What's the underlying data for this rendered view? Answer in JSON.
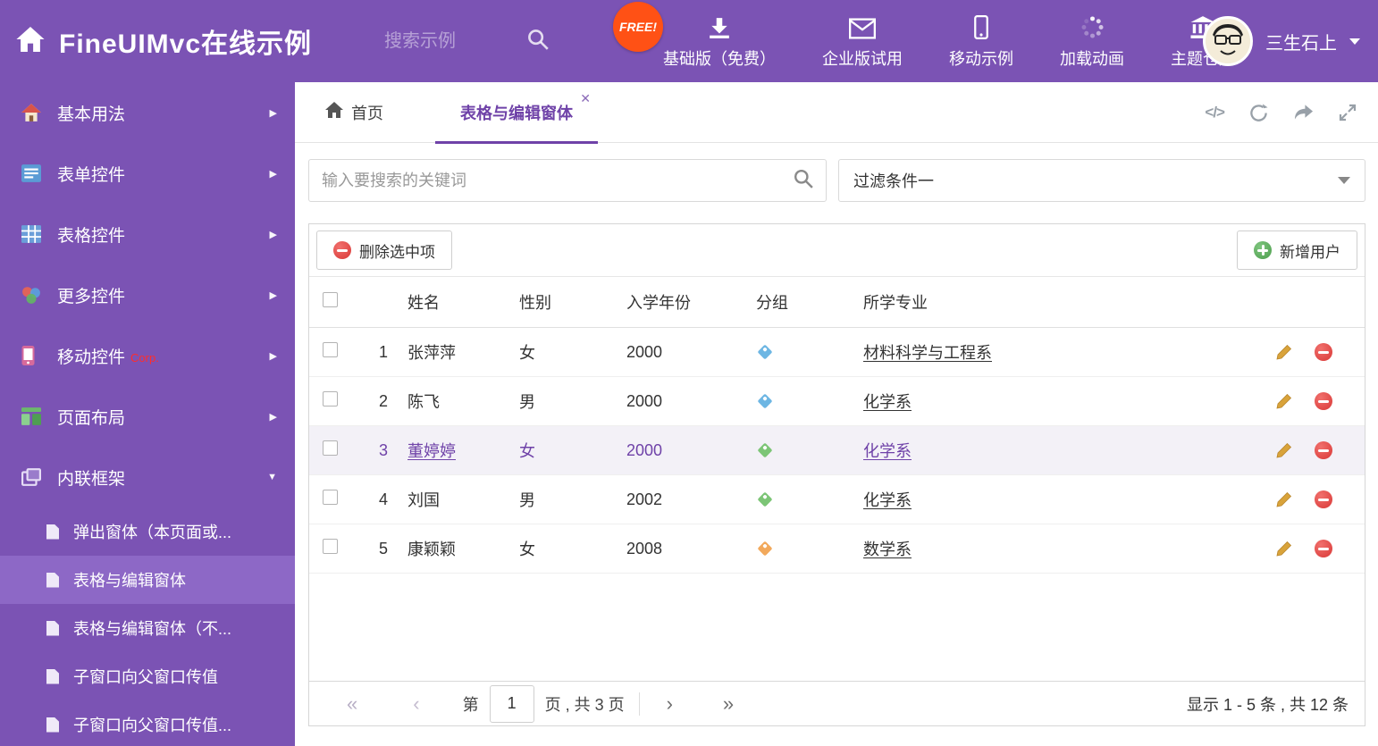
{
  "header": {
    "title": "FineUIMvc在线示例",
    "search_placeholder": "搜索示例",
    "free_badge": "FREE!",
    "nav": [
      {
        "label": "基础版（免费）",
        "icon": "download-icon"
      },
      {
        "label": "企业版试用",
        "icon": "envelope-icon"
      },
      {
        "label": "移动示例",
        "icon": "mobile-icon"
      },
      {
        "label": "加载动画",
        "icon": "spinner-icon"
      },
      {
        "label": "主题仓库",
        "icon": "bank-icon"
      }
    ],
    "user": {
      "name": "三生石上"
    }
  },
  "sidebar": {
    "items": [
      {
        "label": "基本用法"
      },
      {
        "label": "表单控件"
      },
      {
        "label": "表格控件"
      },
      {
        "label": "更多控件"
      },
      {
        "label": "移动控件",
        "badge": "Corp."
      },
      {
        "label": "页面布局"
      },
      {
        "label": "内联框架"
      }
    ],
    "subitems": [
      {
        "label": "弹出窗体（本页面或..."
      },
      {
        "label": "表格与编辑窗体"
      },
      {
        "label": "表格与编辑窗体（不..."
      },
      {
        "label": "子窗口向父窗口传值"
      },
      {
        "label": "子窗口向父窗口传值..."
      }
    ]
  },
  "tabs": {
    "home": "首页",
    "active_tab": "表格与编辑窗体",
    "code_glyph": "</>"
  },
  "filters": {
    "search_placeholder": "输入要搜索的关键词",
    "dropdown_value": "过滤条件一"
  },
  "toolbar": {
    "delete_label": "删除选中项",
    "add_label": "新增用户"
  },
  "table": {
    "columns": [
      "姓名",
      "性别",
      "入学年份",
      "分组",
      "所学专业"
    ],
    "rows": [
      {
        "index": "1",
        "name": "张萍萍",
        "gender": "女",
        "year": "2000",
        "tag_color": "#6db6e3",
        "major": "材料科学与工程系"
      },
      {
        "index": "2",
        "name": "陈飞",
        "gender": "男",
        "year": "2000",
        "tag_color": "#6db6e3",
        "major": "化学系"
      },
      {
        "index": "3",
        "name": "董婷婷",
        "gender": "女",
        "year": "2000",
        "tag_color": "#7cc576",
        "major": "化学系"
      },
      {
        "index": "4",
        "name": "刘国",
        "gender": "男",
        "year": "2002",
        "tag_color": "#7cc576",
        "major": "化学系"
      },
      {
        "index": "5",
        "name": "康颖颖",
        "gender": "女",
        "year": "2008",
        "tag_color": "#f2a95c",
        "major": "数学系"
      }
    ]
  },
  "pagination": {
    "prefix": "第",
    "page_value": "1",
    "suffix": "页 , 共 3 页",
    "summary": "显示 1 - 5 条 , 共 12 条"
  },
  "colors": {
    "accent_purple": "#6f42a8",
    "header_purple": "#7b53b4",
    "active_subitem": "#8d68c6",
    "free_badge": "#ff5115",
    "delete_red": "#d93836",
    "add_green": "#4d9e4d",
    "pencil_gold": "#d9a33a",
    "corp_red": "#ff2d2d"
  }
}
